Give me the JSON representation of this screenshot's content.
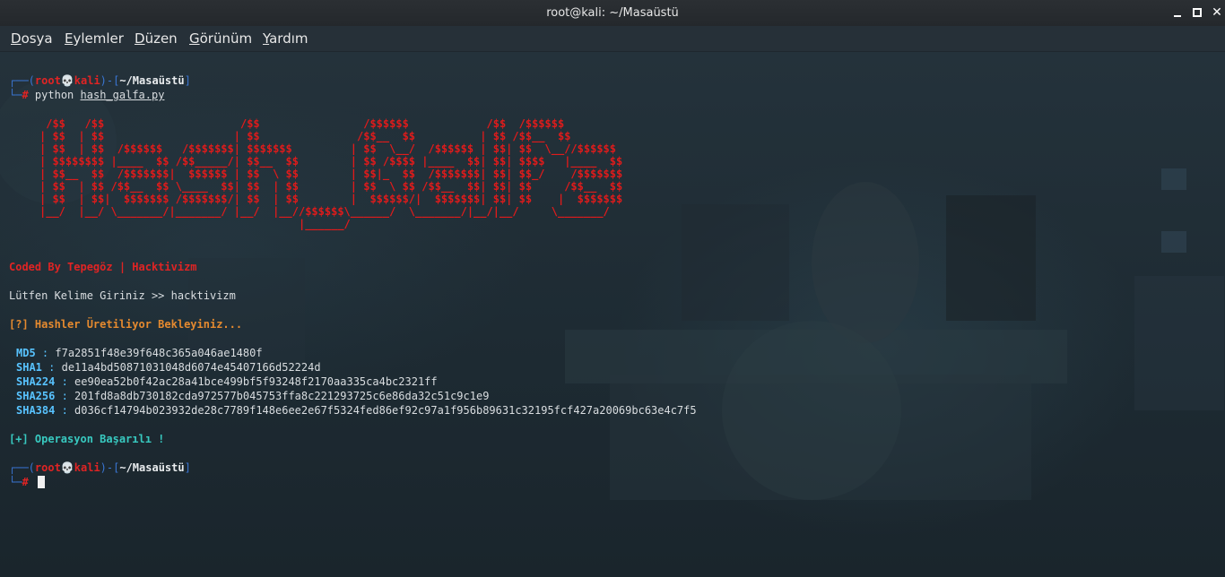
{
  "window": {
    "title": "root@kali: ~/Masaüstü"
  },
  "menu": [
    "Dosya",
    "Eylemler",
    "Düzen",
    "Görünüm",
    "Yardım"
  ],
  "prompt": {
    "user": "root",
    "skull_glyph": "💀",
    "host": "kali",
    "path": "~/Masaüstü",
    "hash_symbol": "#"
  },
  "command": {
    "program": "python",
    "arg": "hash_galfa.py"
  },
  "banner_lines": [
    " /$$   /$$                     /$$                /$$$$$$            /$$  /$$$$$$",
    "| $$  | $$                    | $$               /$$__  $$          | $$ /$$__  $$",
    "| $$  | $$  /$$$$$$   /$$$$$$$| $$$$$$$         | $$  \\__/  /$$$$$$ | $$| $$  \\__//$$$$$$",
    "| $$$$$$$$ |____  $$ /$$_____/| $$__  $$        | $$ /$$$$ |____  $$| $$| $$$$   |____  $$",
    "| $$__  $$  /$$$$$$$|  $$$$$$ | $$  \\ $$        | $$|_  $$  /$$$$$$$| $$| $$_/    /$$$$$$$",
    "| $$  | $$ /$$__  $$ \\____  $$| $$  | $$        | $$  \\ $$ /$$__  $$| $$| $$     /$$__  $$",
    "| $$  | $$|  $$$$$$$ /$$$$$$$/| $$  | $$        |  $$$$$$/|  $$$$$$$| $$| $$    |  $$$$$$$",
    "|__/  |__/ \\_______/|_______/ |__/  |__//$$$$$$\\______/  \\_______/|__/|__/     \\_______/",
    "                                        |______/"
  ],
  "credit": "Coded By Tepegöz | Hacktivizm",
  "input_prompt": "Lütfen Kelime Giriniz >> ",
  "input_value": "hacktivizm",
  "status_wait": "[?] Hashler Üretiliyor Bekleyiniz...",
  "hashes": [
    {
      "name": "MD5",
      "value": "f7a2851f48e39f648c365a046ae1480f"
    },
    {
      "name": "SHA1",
      "value": "de11a4bd50871031048d6074e45407166d52224d"
    },
    {
      "name": "SHA224",
      "value": "ee90ea52b0f42ac28a41bce499bf5f93248f2170aa335ca4bc2321ff"
    },
    {
      "name": "SHA256",
      "value": "201fd8a8db730182cda972577b045753ffa8c221293725c6e86da32c51c9c1e9"
    },
    {
      "name": "SHA384",
      "value": "d036cf14794b023932de28c7789f148e6ee2e67f5324fed86ef92c97a1f956b89631c32195fcf427a20069bc63e4c7f5"
    }
  ],
  "status_done": "[+] Operasyon Başarılı !",
  "colors": {
    "prompt_frame": "#3a76d4",
    "prompt_user": "#e02424",
    "banner": "#e01b1b",
    "credit": "#e02424",
    "status_wait": "#e58a2f",
    "hash_key": "#58c3ff",
    "status_done": "#38c9c0"
  }
}
